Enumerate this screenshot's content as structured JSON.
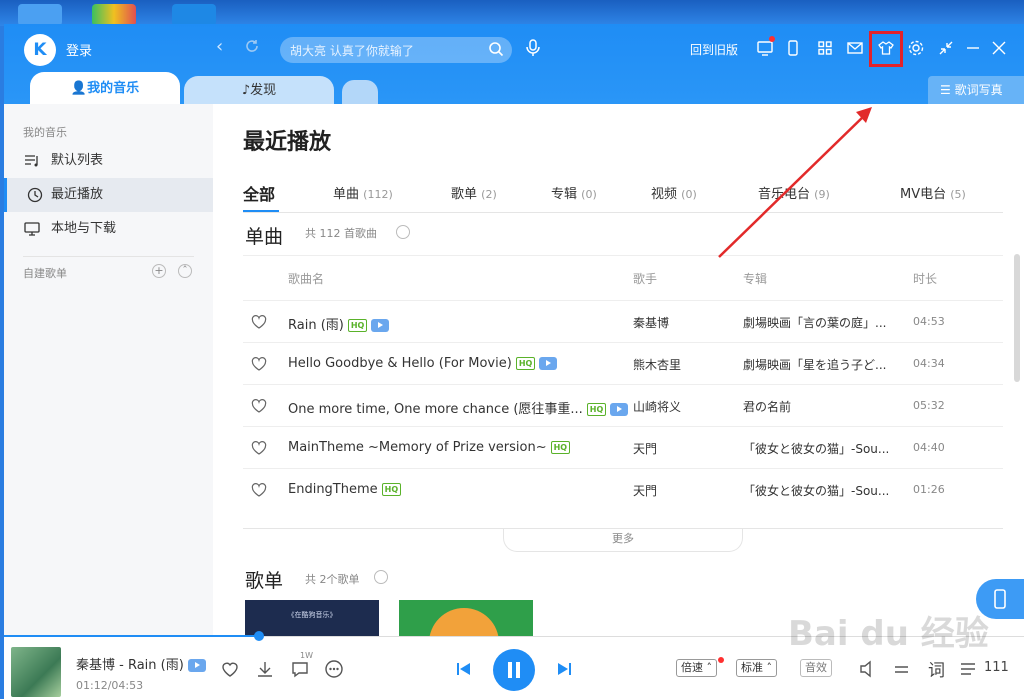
{
  "titlebar": {
    "logo": "K",
    "login": "登录",
    "search_placeholder": "胡大亮 认真了你就输了",
    "old_version": "回到旧版"
  },
  "tabs": {
    "my_music": "我的音乐",
    "discover": "发现",
    "lyrics": "歌词写真"
  },
  "sidebar": {
    "header": "我的音乐",
    "items": [
      {
        "label": "默认列表"
      },
      {
        "label": "最近播放"
      },
      {
        "label": "本地与下载"
      }
    ],
    "custom_header": "自建歌单"
  },
  "main": {
    "title": "最近播放",
    "filter_tabs": [
      {
        "label": "全部",
        "count": ""
      },
      {
        "label": "单曲",
        "count": "(112)"
      },
      {
        "label": "歌单",
        "count": "(2)"
      },
      {
        "label": "专辑",
        "count": "(0)"
      },
      {
        "label": "视频",
        "count": "(0)"
      },
      {
        "label": "音乐电台",
        "count": "(9)"
      },
      {
        "label": "MV电台",
        "count": "(5)"
      }
    ],
    "songs_section": {
      "title": "单曲",
      "count": "共 112 首歌曲"
    },
    "columns": {
      "name": "歌曲名",
      "singer": "歌手",
      "album": "专辑",
      "duration": "时长"
    },
    "songs": [
      {
        "name": "Rain (雨)",
        "hq": "HQ",
        "mv": true,
        "singer": "秦基博",
        "album": "劇場映画「言の葉の庭」...",
        "duration": "04:53"
      },
      {
        "name": "Hello Goodbye & Hello (For Movie)",
        "hq": "HQ",
        "mv": true,
        "singer": "熊木杏里",
        "album": "劇場映画「星を追う子ど...",
        "duration": "04:34"
      },
      {
        "name": "One more time, One more chance (愿往事重...",
        "hq": "HQ",
        "mv": true,
        "singer": "山崎将义",
        "album": "君の名前",
        "duration": "05:32"
      },
      {
        "name": "MainTheme ~Memory of Prize version~",
        "hq": "HQ",
        "mv": false,
        "singer": "天門",
        "album": "「彼女と彼女の猫」-Sou...",
        "duration": "04:40"
      },
      {
        "name": "EndingTheme",
        "hq": "HQ",
        "mv": false,
        "singer": "天門",
        "album": "「彼女と彼女の猫」-Sou...",
        "duration": "01:26"
      }
    ],
    "more": "更多",
    "playlists_section": {
      "title": "歌单",
      "count": "共 2个歌单"
    },
    "playlist_card_text": "《在酷狗音乐》"
  },
  "player": {
    "song": "秦基博 - Rain (雨)",
    "time": "01:12/04:53",
    "comment_count": "1W",
    "progress": 0.25,
    "speed": "倍速",
    "quality": "标准",
    "effect": "音效",
    "lyrics": "词",
    "playlist_count": "111"
  },
  "watermark": "Bai du 经验",
  "colors": {
    "accent": "#1f8df5",
    "highlight": "#e2222b",
    "hq": "#5ab22a"
  }
}
